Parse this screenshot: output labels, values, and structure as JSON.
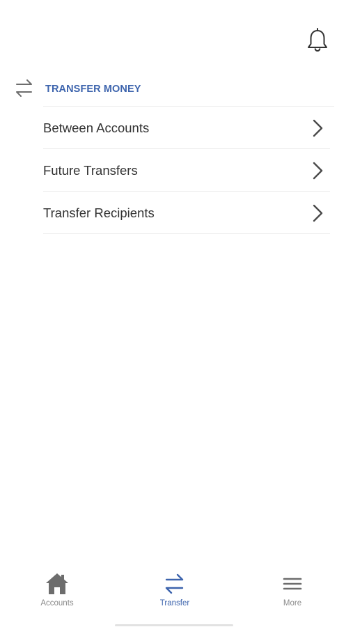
{
  "header": {
    "notification_icon": "bell-icon"
  },
  "section": {
    "icon": "transfer-arrows-icon",
    "title": "TRANSFER MONEY",
    "accent_color": "#3d64ad"
  },
  "menu": {
    "items": [
      {
        "label": "Between Accounts",
        "icon": "chevron-right-icon"
      },
      {
        "label": "Future Transfers",
        "icon": "chevron-right-icon"
      },
      {
        "label": "Transfer Recipients",
        "icon": "chevron-right-icon"
      }
    ]
  },
  "tabbar": {
    "active": "Transfer",
    "tabs": [
      {
        "label": "Accounts",
        "icon": "home-icon"
      },
      {
        "label": "Transfer",
        "icon": "transfer-arrows-icon"
      },
      {
        "label": "More",
        "icon": "menu-icon"
      }
    ],
    "active_color": "#3d64ad",
    "inactive_color": "#6d6d6d"
  }
}
